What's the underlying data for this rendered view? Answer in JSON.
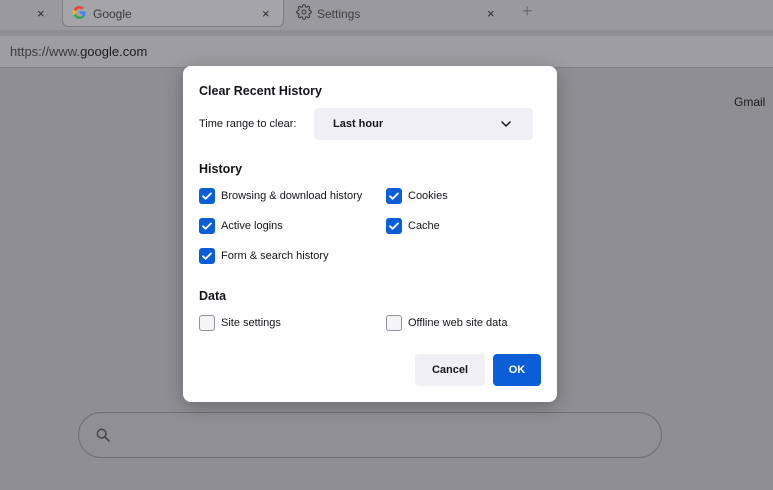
{
  "tabs": [
    {
      "title": "",
      "close": "×"
    },
    {
      "title": "Google",
      "close": "×",
      "favicon": "google-g-icon"
    },
    {
      "title": "Settings",
      "close": "×",
      "favicon": "gear-icon"
    }
  ],
  "new_tab": "+",
  "url": {
    "prefix": "https://www.",
    "host": "google.com"
  },
  "page": {
    "gmail_link": "Gmail",
    "search_icon": "search-icon"
  },
  "dialog": {
    "title": "Clear Recent History",
    "time_range_label": "Time range to clear:",
    "time_range_value": "Last hour",
    "history_section": "History",
    "data_section": "Data",
    "options": {
      "browsing": {
        "label": "Browsing & download history",
        "checked": true
      },
      "cookies": {
        "label": "Cookies",
        "checked": true
      },
      "logins": {
        "label": "Active logins",
        "checked": true
      },
      "cache": {
        "label": "Cache",
        "checked": true
      },
      "forms": {
        "label": "Form & search history",
        "checked": true
      },
      "site_settings": {
        "label": "Site settings",
        "checked": false
      },
      "offline": {
        "label": "Offline web site data",
        "checked": false
      }
    },
    "cancel_label": "Cancel",
    "ok_label": "OK"
  },
  "colors": {
    "accent": "#0a5fd8",
    "dialog_bg": "#ffffff",
    "overlay_bg": "#8f8e92"
  }
}
